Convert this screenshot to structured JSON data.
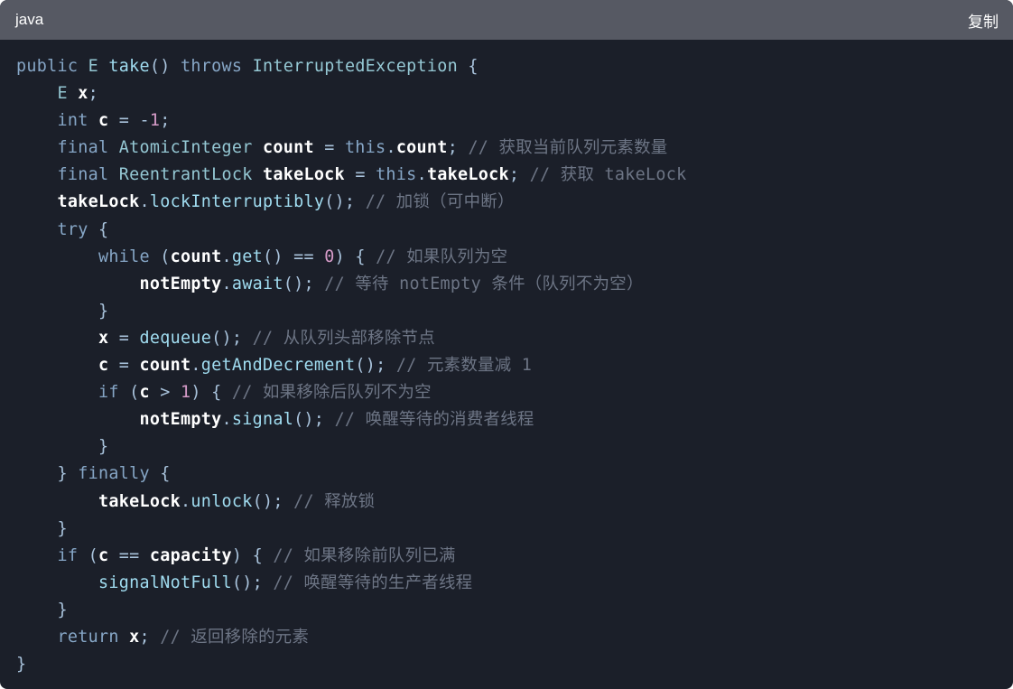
{
  "header": {
    "language": "java",
    "copy_label": "复制"
  },
  "colors": {
    "keyword": "#86a6c6",
    "type": "#95c8d4",
    "identifier": "#ffffff",
    "function": "#a0dcf0",
    "operator": "#a9c3dc",
    "number": "#d79cc9",
    "comment": "#6d7585",
    "background": "#1b1f29",
    "header_background": "#565963"
  },
  "code": {
    "lines": [
      [
        [
          "kw",
          "public "
        ],
        [
          "type",
          "E "
        ],
        [
          "fn",
          "take"
        ],
        [
          "op",
          "() "
        ],
        [
          "kw",
          "throws "
        ],
        [
          "type",
          "InterruptedException "
        ],
        [
          "op",
          "{"
        ]
      ],
      [
        [
          "kw",
          "    "
        ],
        [
          "type",
          "E "
        ],
        [
          "id",
          "x"
        ],
        [
          "op",
          ";"
        ]
      ],
      [
        [
          "kw",
          "    int "
        ],
        [
          "id",
          "c "
        ],
        [
          "op",
          "= -"
        ],
        [
          "num",
          "1"
        ],
        [
          "op",
          ";"
        ]
      ],
      [
        [
          "kw",
          "    final "
        ],
        [
          "type",
          "AtomicInteger "
        ],
        [
          "id",
          "count "
        ],
        [
          "op",
          "= "
        ],
        [
          "kw",
          "this"
        ],
        [
          "op",
          "."
        ],
        [
          "id",
          "count"
        ],
        [
          "op",
          "; "
        ],
        [
          "cm",
          "// 获取当前队列元素数量"
        ]
      ],
      [
        [
          "kw",
          "    final "
        ],
        [
          "type",
          "ReentrantLock "
        ],
        [
          "id",
          "takeLock "
        ],
        [
          "op",
          "= "
        ],
        [
          "kw",
          "this"
        ],
        [
          "op",
          "."
        ],
        [
          "id",
          "takeLock"
        ],
        [
          "op",
          "; "
        ],
        [
          "cm",
          "// 获取 takeLock"
        ]
      ],
      [
        [
          "kw",
          "    "
        ],
        [
          "id",
          "takeLock"
        ],
        [
          "op",
          "."
        ],
        [
          "fn",
          "lockInterruptibly"
        ],
        [
          "op",
          "(); "
        ],
        [
          "cm",
          "// 加锁（可中断）"
        ]
      ],
      [
        [
          "kw",
          "    try "
        ],
        [
          "op",
          "{"
        ]
      ],
      [
        [
          "kw",
          "        while "
        ],
        [
          "op",
          "("
        ],
        [
          "id",
          "count"
        ],
        [
          "op",
          "."
        ],
        [
          "fn",
          "get"
        ],
        [
          "op",
          "() == "
        ],
        [
          "num",
          "0"
        ],
        [
          "op",
          ") { "
        ],
        [
          "cm",
          "// 如果队列为空"
        ]
      ],
      [
        [
          "kw",
          "            "
        ],
        [
          "id",
          "notEmpty"
        ],
        [
          "op",
          "."
        ],
        [
          "fn",
          "await"
        ],
        [
          "op",
          "(); "
        ],
        [
          "cm",
          "// 等待 notEmpty 条件（队列不为空）"
        ]
      ],
      [
        [
          "op",
          "        }"
        ]
      ],
      [
        [
          "kw",
          "        "
        ],
        [
          "id",
          "x "
        ],
        [
          "op",
          "= "
        ],
        [
          "fn",
          "dequeue"
        ],
        [
          "op",
          "(); "
        ],
        [
          "cm",
          "// 从队列头部移除节点"
        ]
      ],
      [
        [
          "kw",
          "        "
        ],
        [
          "id",
          "c "
        ],
        [
          "op",
          "= "
        ],
        [
          "id",
          "count"
        ],
        [
          "op",
          "."
        ],
        [
          "fn",
          "getAndDecrement"
        ],
        [
          "op",
          "(); "
        ],
        [
          "cm",
          "// 元素数量减 1"
        ]
      ],
      [
        [
          "kw",
          "        if "
        ],
        [
          "op",
          "("
        ],
        [
          "id",
          "c "
        ],
        [
          "op",
          "> "
        ],
        [
          "num",
          "1"
        ],
        [
          "op",
          ") { "
        ],
        [
          "cm",
          "// 如果移除后队列不为空"
        ]
      ],
      [
        [
          "kw",
          "            "
        ],
        [
          "id",
          "notEmpty"
        ],
        [
          "op",
          "."
        ],
        [
          "fn",
          "signal"
        ],
        [
          "op",
          "(); "
        ],
        [
          "cm",
          "// 唤醒等待的消费者线程"
        ]
      ],
      [
        [
          "op",
          "        }"
        ]
      ],
      [
        [
          "op",
          "    } "
        ],
        [
          "kw",
          "finally "
        ],
        [
          "op",
          "{"
        ]
      ],
      [
        [
          "kw",
          "        "
        ],
        [
          "id",
          "takeLock"
        ],
        [
          "op",
          "."
        ],
        [
          "fn",
          "unlock"
        ],
        [
          "op",
          "(); "
        ],
        [
          "cm",
          "// 释放锁"
        ]
      ],
      [
        [
          "op",
          "    }"
        ]
      ],
      [
        [
          "kw",
          "    if "
        ],
        [
          "op",
          "("
        ],
        [
          "id",
          "c "
        ],
        [
          "op",
          "== "
        ],
        [
          "id",
          "capacity"
        ],
        [
          "op",
          ") { "
        ],
        [
          "cm",
          "// 如果移除前队列已满"
        ]
      ],
      [
        [
          "kw",
          "        "
        ],
        [
          "fn",
          "signalNotFull"
        ],
        [
          "op",
          "(); "
        ],
        [
          "cm",
          "// 唤醒等待的生产者线程"
        ]
      ],
      [
        [
          "op",
          "    }"
        ]
      ],
      [
        [
          "kw",
          "    return "
        ],
        [
          "id",
          "x"
        ],
        [
          "op",
          "; "
        ],
        [
          "cm",
          "// 返回移除的元素"
        ]
      ],
      [
        [
          "op",
          "}"
        ]
      ]
    ]
  }
}
